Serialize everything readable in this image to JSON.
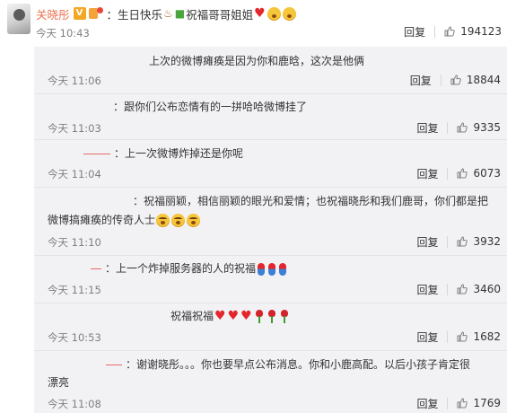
{
  "main_post": {
    "author": "关晓彤",
    "verified_badge": "V",
    "text": "：生日快乐",
    "text_suffix": "祝福哥哥姐姐",
    "time": "今天 10:43",
    "reply_label": "回复",
    "likes": "194123"
  },
  "reposts": [
    {
      "text": "上次的微博瘫痪是因为你和鹿晗，这次是他俩",
      "time": "今天 11:06",
      "reply_label": "回复",
      "likes": "18844"
    },
    {
      "text": "：跟你们公布恋情有的一拼哈哈微博挂了",
      "time": "今天 11:03",
      "reply_label": "回复",
      "likes": "9335"
    },
    {
      "text": "：上一次微博炸掉还是你呢",
      "time": "今天 11:04",
      "reply_label": "回复",
      "likes": "6073"
    },
    {
      "text": "：祝福丽颖，相信丽颖的眼光和爱情；也祝福晓彤和我们鹿哥，你们都是把",
      "text2": "微博搞瘫痪的传奇人士",
      "time": "今天 11:10",
      "reply_label": "回复",
      "likes": "3932"
    },
    {
      "text": "：上一个炸掉服务器的人的祝福",
      "time": "今天 11:15",
      "reply_label": "回复",
      "likes": "3460"
    },
    {
      "text": "祝福祝福",
      "time": "今天 10:53",
      "reply_label": "回复",
      "likes": "1682"
    },
    {
      "text": "：谢谢晓彤。。。你也要早点公布消息。你和小鹿高配。以后小孩子肯定很",
      "text2": "漂亮",
      "time": "今天 11:08",
      "reply_label": "回复",
      "likes": "1769"
    }
  ],
  "colors": {
    "username": "#eb7350",
    "repost_bg": "#f2f2f5",
    "time": "#808080"
  },
  "icons": [
    "thumbs-up-icon",
    "verified-v-icon",
    "heart-icon",
    "laughing-face-icon",
    "rose-icon",
    "capsule-icon"
  ]
}
